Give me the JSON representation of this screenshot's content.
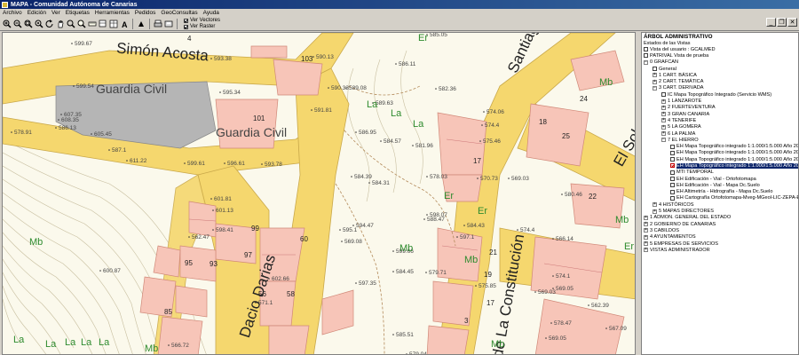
{
  "window": {
    "title": "MAPA - Comunidad Autónoma de Canarias"
  },
  "menu": [
    "Archivo",
    "Edición",
    "Ver",
    "Etiquetas",
    "Herramientas",
    "Pedidos",
    "GeoConsultas",
    "Ayuda"
  ],
  "toolbar": {
    "icons": [
      "zoom-in",
      "zoom-out",
      "zoom-window",
      "zoom-extent",
      "refresh",
      "pan",
      "identify",
      "find",
      "measure",
      "layers",
      "table",
      "info",
      "sync",
      "print",
      "export",
      "settings"
    ],
    "view_vectors": "Ver Vectores",
    "view_raster": "Ver Raster"
  },
  "window_controls": {
    "minimize": "_",
    "restore": "❐",
    "close": "✕"
  },
  "map": {
    "street_labels": [
      "Simón Acosta",
      "Guardia Civil",
      "Guardia Civil",
      "Santiago",
      "El Sol",
      "Dacio Darias",
      "de La Constitución"
    ],
    "zone_labels": [
      "Er",
      "La",
      "La",
      "La",
      "Mb",
      "Er",
      "Er",
      "Mb",
      "Mb",
      "La",
      "La",
      "La",
      "La",
      "La",
      "Mb",
      "Mb",
      "Mb",
      "Er",
      "Mb"
    ],
    "building_numbers": [
      "4",
      "103",
      "101",
      "17",
      "18",
      "25",
      "22",
      "99",
      "60",
      "97",
      "93",
      "95",
      "58",
      "56",
      "85",
      "21",
      "19",
      "17",
      "3",
      "24"
    ],
    "elevations": [
      "599.67",
      "599.54",
      "593.38",
      "590.13",
      "585.05",
      "582.36",
      "574.06",
      "595.34",
      "590.33",
      "589.08",
      "586.11",
      "589.63",
      "574.4",
      "591.81",
      "586.95",
      "584.57",
      "581.96",
      "575.46",
      "599.61",
      "596.61",
      "593.78",
      "587.1",
      "584.39",
      "584.31",
      "578.03",
      "570.73",
      "569.03",
      "586.13",
      "578.91",
      "601.81",
      "601.13",
      "598.41",
      "595.1",
      "594.47",
      "588.47",
      "584.43",
      "580.46",
      "574.4",
      "566.14",
      "571.1",
      "569.08",
      "599.66",
      "598.07",
      "597.1",
      "584.45",
      "579.71",
      "575.85",
      "574.1",
      "569.05",
      "562.47",
      "602.66",
      "597.35",
      "585.51",
      "579.04",
      "578.47",
      "566.72",
      "600.87",
      "608.35",
      "607.35",
      "605.45",
      "611.22",
      "569.03",
      "569.05",
      "562.39",
      "567.09"
    ]
  },
  "tree": {
    "title": "ÁRBOL ADMINISTRATIVO",
    "subtitle": "Estados de las Vistas",
    "nodes": [
      {
        "level": 0,
        "exp": "",
        "box": true,
        "checked": false,
        "label": "Vista del usuario : GCALMED"
      },
      {
        "level": 0,
        "exp": "",
        "box": true,
        "checked": false,
        "label": "PATRIVAL Vista de prueba"
      },
      {
        "level": 0,
        "exp": "-",
        "box": false,
        "checked": false,
        "label": "0 GRAFCAN"
      },
      {
        "level": 1,
        "exp": "",
        "box": true,
        "checked": false,
        "label": "General"
      },
      {
        "level": 1,
        "exp": "+",
        "box": false,
        "checked": false,
        "label": "1 CART. BÁSICA"
      },
      {
        "level": 1,
        "exp": "+",
        "box": false,
        "checked": false,
        "label": "2 CART. TEMÁTICA"
      },
      {
        "level": 1,
        "exp": "-",
        "box": false,
        "checked": false,
        "label": "3 CART. DERIVADA"
      },
      {
        "level": 2,
        "exp": "",
        "box": true,
        "checked": false,
        "label": "IC Mapa Topográfico Integrado (Servicio WMS)"
      },
      {
        "level": 2,
        "exp": "+",
        "box": false,
        "checked": false,
        "label": "1 LANZAROTE"
      },
      {
        "level": 2,
        "exp": "+",
        "box": false,
        "checked": false,
        "label": "2 FUERTEVENTURA"
      },
      {
        "level": 2,
        "exp": "+",
        "box": false,
        "checked": false,
        "label": "3 GRAN CANARIA"
      },
      {
        "level": 2,
        "exp": "+",
        "box": false,
        "checked": false,
        "label": "4 TENERIFE"
      },
      {
        "level": 2,
        "exp": "+",
        "box": false,
        "checked": false,
        "label": "5 LA GOMERA"
      },
      {
        "level": 2,
        "exp": "+",
        "box": false,
        "checked": false,
        "label": "6 LA PALMA"
      },
      {
        "level": 2,
        "exp": "-",
        "box": false,
        "checked": false,
        "label": "7 EL HIERRO"
      },
      {
        "level": 3,
        "exp": "",
        "box": true,
        "checked": false,
        "label": "EH Mapa Topográfico integrado 1:1.000/1:5.000 Año 2010"
      },
      {
        "level": 3,
        "exp": "",
        "box": true,
        "checked": false,
        "label": "EH Mapa Topográfico integrado 1:1.000/1:5.000 Año 2011"
      },
      {
        "level": 3,
        "exp": "",
        "box": true,
        "checked": false,
        "label": "EH Mapa Topográfico integrado 1:1.000/1:5.000 Año 2013"
      },
      {
        "level": 3,
        "exp": "",
        "box": true,
        "checked": true,
        "selected": true,
        "label": "EH Mapa Topográfico integrado 1:1.000/1:5.000 Año 2016"
      },
      {
        "level": 3,
        "exp": "",
        "box": true,
        "checked": false,
        "label": "MTI TEMPORAL"
      },
      {
        "level": 3,
        "exp": "",
        "box": true,
        "checked": false,
        "label": "EH Edificación - Vial - Ortofotomapa"
      },
      {
        "level": 3,
        "exp": "",
        "box": true,
        "checked": false,
        "label": "EH Edificación - Vial - Mapa Dc.Suelo"
      },
      {
        "level": 3,
        "exp": "",
        "box": true,
        "checked": false,
        "label": "EH Altimetría - Hidrografía - Mapa Dc.Suelo"
      },
      {
        "level": 3,
        "exp": "",
        "box": true,
        "checked": false,
        "label": "EH Cartografía Ortofotomapa-Mveg-MGeol-LIC-ZEPA-EENN-M"
      },
      {
        "level": 1,
        "exp": "+",
        "box": false,
        "checked": false,
        "label": "4 HISTÓRICOS"
      },
      {
        "level": 1,
        "exp": "+",
        "box": false,
        "checked": false,
        "label": "5 MAPAS DIRECTORES"
      },
      {
        "level": 0,
        "exp": "+",
        "box": false,
        "checked": false,
        "label": "1 ADMON. GENERAL DEL ESTADO"
      },
      {
        "level": 0,
        "exp": "+",
        "box": false,
        "checked": false,
        "label": "2 GOBIERNO DE CANARIAS"
      },
      {
        "level": 0,
        "exp": "+",
        "box": false,
        "checked": false,
        "label": "3 CABILDOS"
      },
      {
        "level": 0,
        "exp": "+",
        "box": false,
        "checked": false,
        "label": "4 AYUNTAMIENTOS"
      },
      {
        "level": 0,
        "exp": "+",
        "box": false,
        "checked": false,
        "label": "5 EMPRESAS DE SERVICIOS"
      },
      {
        "level": 0,
        "exp": "+",
        "box": false,
        "checked": false,
        "label": "VISTAS ADMINISTRADOR"
      }
    ]
  },
  "colors": {
    "road": "#f5d76e",
    "building": "#f7c5b8",
    "building_dark": "#e9a898",
    "block": "#f4b4a2",
    "background": "#fbf9ec",
    "zone_label": "#2e8b2e",
    "selection": "#0a246a"
  }
}
